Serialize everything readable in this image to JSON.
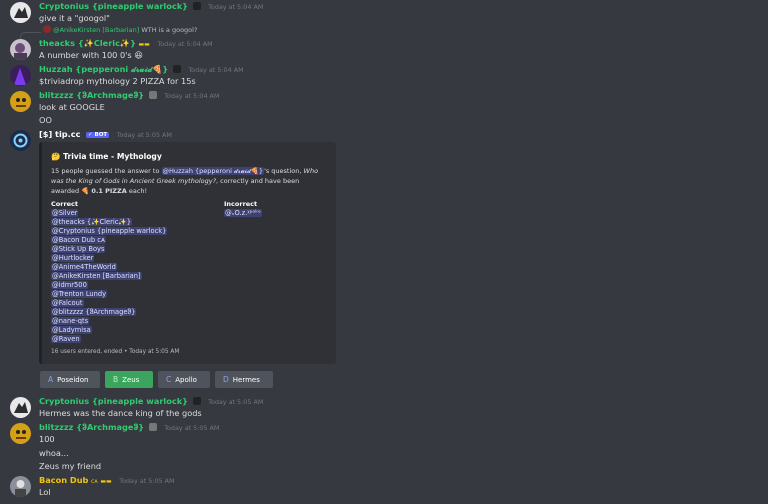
{
  "messages": {
    "m1": {
      "author": "Cryptonius {pineapple warlock}",
      "emoji": "🏴",
      "time": "Today at 5:04 AM",
      "lines": [
        "give it a \"googol\""
      ]
    },
    "reply": {
      "author": "@AnikeKirsten [Barbarian]",
      "text": "WTH is a googol?"
    },
    "m2": {
      "author": "theacks {✨Cleric✨}",
      "tag": "▬▬",
      "time": "Today at 5:04 AM",
      "lines": [
        "A number with 100 0's"
      ],
      "emoji": "😆"
    },
    "m3": {
      "author": "Huzzah {pepperoni 𝓭𝓻𝓾𝓲𝓭🍕}",
      "time": "Today at 5:04 AM",
      "lines": [
        "$triviadrop mythology 2 PIZZA for 15s"
      ]
    },
    "m4": {
      "author": "blitzzzz {ჵArchmageჵ}",
      "time": "Today at 5:04 AM",
      "lines": [
        "look at GOOGLE",
        "OO"
      ]
    },
    "m5": {
      "author": "[$] tip.cc",
      "bot": "✓ BOT",
      "time": "Today at 5:05 AM"
    },
    "m6": {
      "author": "Cryptonius {pineapple warlock}",
      "time": "Today at 5:05 AM",
      "lines": [
        "Hermes was the dance king of the gods"
      ]
    },
    "m7": {
      "author": "blitzzzz {ჵArchmageჵ}",
      "time": "Today at 5:05 AM",
      "lines": [
        "100",
        "whoa...",
        "Zeus my friend"
      ]
    },
    "m8": {
      "author": "Bacon Dub",
      "suffix": "ᴄᴀ",
      "tag": "▬▬",
      "time": "Today at 5:05 AM",
      "lines": [
        "Lol"
      ]
    }
  },
  "embed": {
    "title": "🤔 Trivia time - Mythology",
    "desc_pre": "15 people guessed the answer to ",
    "desc_mention": "@Huzzah {pepperoni 𝓭𝓻𝓾𝓲𝓭🍕}",
    "desc_mid": "'s question, ",
    "desc_question": "Who was the King of Gods in Ancient Greek mythology?",
    "desc_post": ", correctly and have been awarded ",
    "desc_reward": "0.1 PIZZA",
    "desc_end": " each!",
    "correct_label": "Correct",
    "incorrect_label": "Incorrect",
    "correct": [
      "@Silver",
      "@theacks {✨Cleric✨}",
      "@Cryptonius {pineapple warlock}",
      "@Bacon Dub ᴄᴀ",
      "@Stick Up Boys",
      "@Hurtlocker",
      "@Anime4TheWorld",
      "@AnikeKirsten [Barbarian]",
      "@idmr500",
      "@Trenton Lundy",
      "@Falcout",
      "@blitzzzz {ჵArchmageჵ}",
      "@nane-qts",
      "@Ladymisa",
      "@Raven"
    ],
    "incorrect": [
      "@ᵥO.z.ᵡᵖᵒᵏᵉ"
    ],
    "footer": "16 users entered, ended • Today at 5:05 AM"
  },
  "buttons": [
    {
      "key": "A",
      "label": "Poseidon"
    },
    {
      "key": "B",
      "label": "Zeus"
    },
    {
      "key": "C",
      "label": "Apollo"
    },
    {
      "key": "D",
      "label": "Hermes"
    }
  ],
  "colors": {
    "green_name": "#2ecc71",
    "gold_name": "#f1c40f",
    "bg": "#36393f",
    "embed_bg": "#2f3136",
    "button_green": "#3ba55d",
    "button_grey": "#4f545c"
  }
}
